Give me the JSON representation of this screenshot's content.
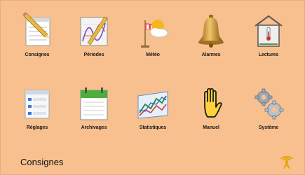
{
  "menu": {
    "items": [
      {
        "label": "Consignes",
        "icon": "notepad-pencil-icon"
      },
      {
        "label": "Périodes",
        "icon": "chart-pencil-icon"
      },
      {
        "label": "Météo",
        "icon": "weather-sun-cloud-icon"
      },
      {
        "label": "Alarmes",
        "icon": "bell-icon"
      },
      {
        "label": "Lectures",
        "icon": "thermometer-house-icon"
      },
      {
        "label": "Réglages",
        "icon": "settings-window-icon"
      },
      {
        "label": "Archivages",
        "icon": "calendar-archive-icon"
      },
      {
        "label": "Statistiques",
        "icon": "stats-graph-icon"
      },
      {
        "label": "Manuel",
        "icon": "hand-icon"
      },
      {
        "label": "Système",
        "icon": "gears-icon"
      }
    ]
  },
  "footer": {
    "title": "Consignes",
    "status_icon": "wireless-signal-icon"
  },
  "colors": {
    "background": "#f8c08f",
    "status_icon": "#e0a400"
  }
}
